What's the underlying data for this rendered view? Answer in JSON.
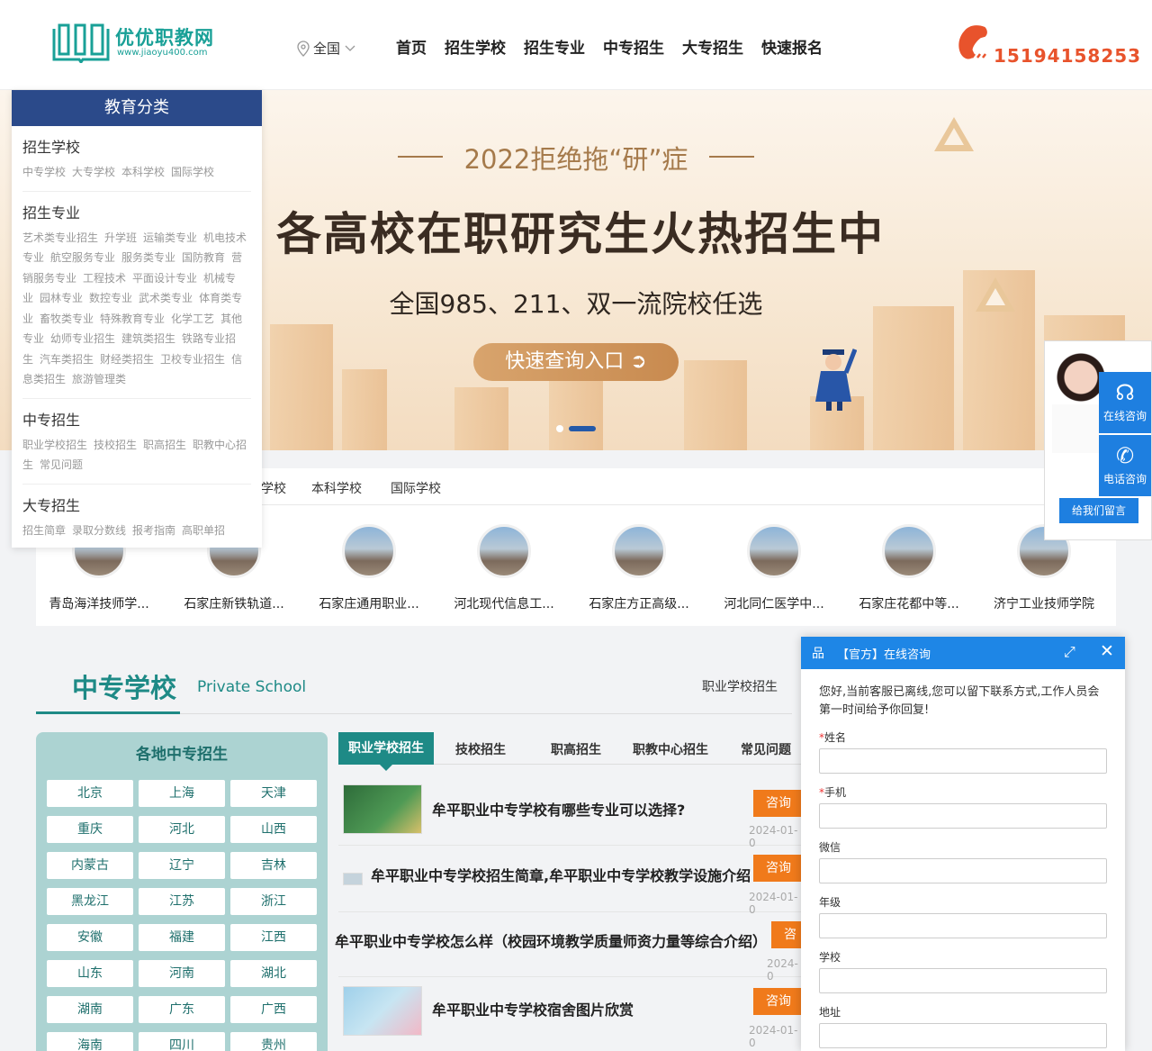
{
  "header": {
    "logo_name": "优优职教网",
    "logo_url": "www.jiaoyu400.com",
    "region": "全国",
    "nav": [
      "首页",
      "招生学校",
      "招生专业",
      "中专招生",
      "大专招生",
      "快速报名"
    ],
    "phone": "15194158253"
  },
  "banner": {
    "subtitle": "2022拒绝拖“研”症",
    "headline": "各高校在职研究生火热招生中",
    "desc": "全国985、211、双一流院校任选",
    "button": "快速查询入口 ➲"
  },
  "categories": {
    "title": "教育分类",
    "groups": [
      {
        "title": "招生学校",
        "links": [
          "中专学校",
          "大专学校",
          "本科学校",
          "国际学校"
        ]
      },
      {
        "title": "招生专业",
        "links": [
          "艺术类专业招生",
          "升学班",
          "运输类专业",
          "机电技术专业",
          "航空服务专业",
          "服务类专业",
          "国防教育",
          "营销服务专业",
          "工程技术",
          "平面设计专业",
          "机械专业",
          "园林专业",
          "数控专业",
          "武术类专业",
          "体育类专业",
          "畜牧类专业",
          "特殊教育专业",
          "化学工艺",
          "其他专业",
          "幼师专业招生",
          "建筑类招生",
          "铁路专业招生",
          "汽车类招生",
          "财经类招生",
          "卫校专业招生",
          "信息类招生",
          "旅游管理类"
        ]
      },
      {
        "title": "中专招生",
        "links": [
          "职业学校招生",
          "技校招生",
          "职高招生",
          "职教中心招生",
          "常见问题"
        ]
      },
      {
        "title": "大专招生",
        "links": [
          "招生简章",
          "录取分数线",
          "报考指南",
          "高职单招"
        ]
      }
    ]
  },
  "school_tabs": [
    "学校",
    "本科学校",
    "国际学校"
  ],
  "schools": [
    "青岛海洋技师学...",
    "石家庄新铁轨道...",
    "石家庄通用职业...",
    "河北现代信息工...",
    "石家庄方正高级...",
    "河北同仁医学中...",
    "石家庄花都中等...",
    "济宁工业技师学院"
  ],
  "section": {
    "title_cn": "中专学校",
    "title_en": "Private School",
    "right_link": "职业学校招生"
  },
  "regions": {
    "title": "各地中专招生",
    "items": [
      "北京",
      "上海",
      "天津",
      "重庆",
      "河北",
      "山西",
      "内蒙古",
      "辽宁",
      "吉林",
      "黑龙江",
      "江苏",
      "浙江",
      "安徽",
      "福建",
      "江西",
      "山东",
      "河南",
      "湖北",
      "湖南",
      "广东",
      "广西",
      "海南",
      "四川",
      "贵州"
    ]
  },
  "news": {
    "tabs": [
      "职业学校招生",
      "技校招生",
      "职高招生",
      "职教中心招生",
      "常见问题"
    ],
    "items": [
      {
        "title": "牟平职业中专学校有哪些专业可以选择?",
        "ask": "咨询",
        "date": "2024-01-0"
      },
      {
        "title": "牟平职业中专学校招生简章,牟平职业中专学校教学设施介绍",
        "ask": "咨询",
        "date": "2024-01-0"
      },
      {
        "title": "牟平职业中专学校怎么样（校园环境教学质量师资力量等综合介绍）",
        "ask": "咨",
        "date": "2024-0"
      },
      {
        "title": "牟平职业中专学校宿舍图片欣赏",
        "ask": "咨询",
        "date": "2024-01-0"
      }
    ]
  },
  "float": {
    "online": "在线咨询",
    "phone": "电话咨询",
    "message": "给我们留言"
  },
  "chat": {
    "title": "【官方】在线咨询",
    "intro": "您好,当前客服已离线,您可以留下联系方式,工作人员会第一时间给予你回复!",
    "fields": [
      {
        "label": "姓名",
        "required": "*"
      },
      {
        "label": "手机",
        "required": "*"
      },
      {
        "label": "微信",
        "required": ""
      },
      {
        "label": "年级",
        "required": ""
      },
      {
        "label": "学校",
        "required": ""
      },
      {
        "label": "地址",
        "required": ""
      }
    ]
  },
  "colors": {
    "teal": "#1e8a86",
    "navy": "#2b4a8a",
    "orange": "#f07a1b",
    "blue": "#1e86e6",
    "phone_red": "#e8532c"
  }
}
